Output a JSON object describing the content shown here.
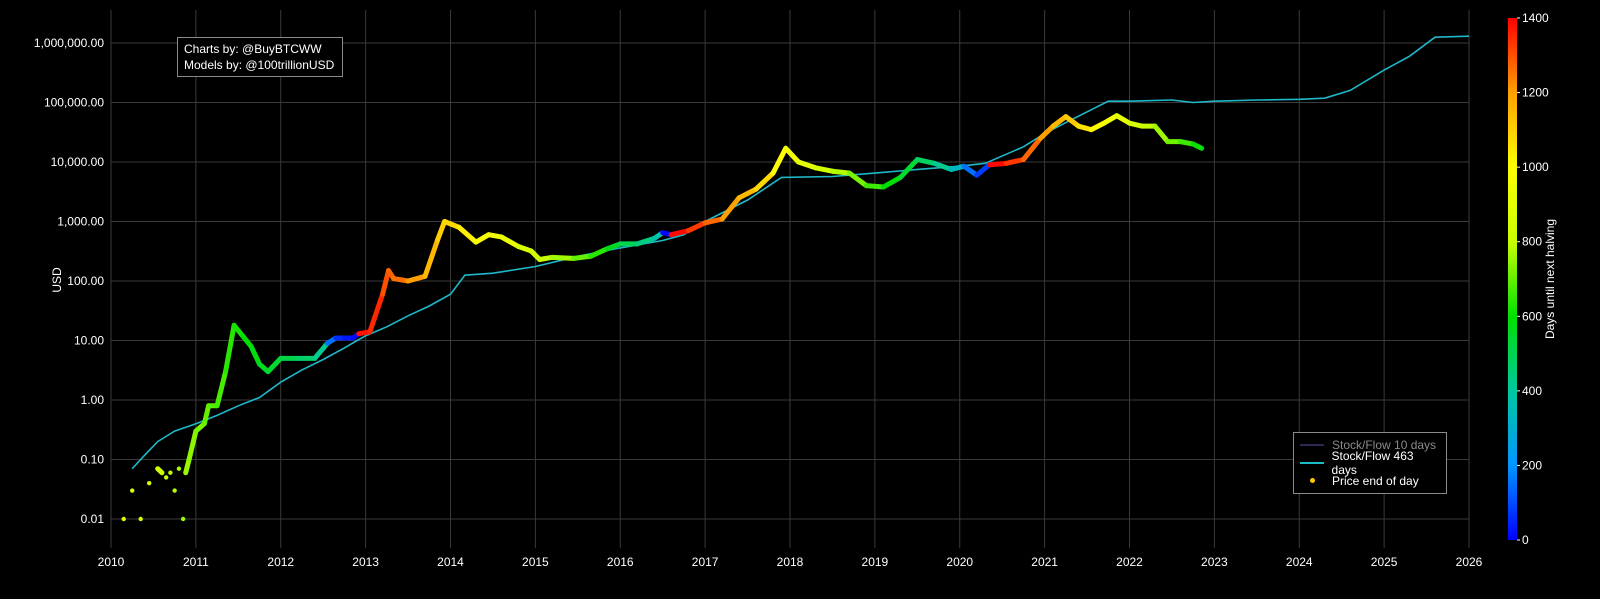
{
  "credits": {
    "line1": "Charts by: @BuyBTCWW",
    "line2": "Models by: @100trillionUSD"
  },
  "legend": {
    "sf10_label": "Stock/Flow 10 days",
    "sf463_label": "Stock/Flow 463 days",
    "price_label": "Price end of day"
  },
  "colors": {
    "background": "#000000",
    "grid": "#3a3a3a",
    "model_line": "#1fb8c8",
    "sf10_line": "#2a2a55",
    "colorbar_stops": [
      "#0000ff",
      "#0096ff",
      "#00c8a0",
      "#00e000",
      "#c8ff00",
      "#ffff00",
      "#ffa000",
      "#ff0000"
    ]
  },
  "chart_data": {
    "type": "scatter",
    "title": "",
    "xlabel": "",
    "ylabel": "USD",
    "y_scale": "log",
    "xlim": [
      2010,
      2026
    ],
    "ylim": [
      0.01,
      1000000
    ],
    "x_ticks": [
      "2010",
      "2011",
      "2012",
      "2013",
      "2014",
      "2015",
      "2016",
      "2017",
      "2018",
      "2019",
      "2020",
      "2021",
      "2022",
      "2023",
      "2024",
      "2025",
      "2026"
    ],
    "y_ticks": [
      {
        "value": 0.01,
        "label": "0.01"
      },
      {
        "value": 0.1,
        "label": "0.10"
      },
      {
        "value": 1,
        "label": "1.00"
      },
      {
        "value": 10,
        "label": "10.00"
      },
      {
        "value": 100,
        "label": "100.00"
      },
      {
        "value": 1000,
        "label": "1,000.00"
      },
      {
        "value": 10000,
        "label": "10,000.00"
      },
      {
        "value": 100000,
        "label": "100,000.00"
      },
      {
        "value": 1000000,
        "label": "1,000,000.00"
      }
    ],
    "grid": true,
    "legend_position": "bottom-right",
    "colorbar": {
      "label": "Days until next halving",
      "range": [
        0,
        1400
      ],
      "ticks": [
        0,
        200,
        400,
        600,
        800,
        1000,
        1200,
        1400
      ]
    },
    "series": [
      {
        "name": "Stock/Flow 463 days",
        "kind": "line",
        "points": [
          [
            2010.25,
            0.07
          ],
          [
            2010.4,
            0.12
          ],
          [
            2010.55,
            0.2
          ],
          [
            2010.75,
            0.3
          ],
          [
            2011.0,
            0.4
          ],
          [
            2011.25,
            0.55
          ],
          [
            2011.5,
            0.8
          ],
          [
            2011.75,
            1.1
          ],
          [
            2012.0,
            2.0
          ],
          [
            2012.25,
            3.2
          ],
          [
            2012.5,
            4.8
          ],
          [
            2012.75,
            7.5
          ],
          [
            2012.9,
            10
          ],
          [
            2013.0,
            12
          ],
          [
            2013.25,
            17
          ],
          [
            2013.5,
            26
          ],
          [
            2013.75,
            38
          ],
          [
            2014.0,
            60
          ],
          [
            2014.17,
            125
          ],
          [
            2014.5,
            135
          ],
          [
            2015.0,
            175
          ],
          [
            2015.5,
            260
          ],
          [
            2016.0,
            360
          ],
          [
            2016.5,
            480
          ],
          [
            2016.75,
            600
          ],
          [
            2017.0,
            1000
          ],
          [
            2017.5,
            2300
          ],
          [
            2017.9,
            5500
          ],
          [
            2018.5,
            5700
          ],
          [
            2019.0,
            6500
          ],
          [
            2019.5,
            7500
          ],
          [
            2020.0,
            8500
          ],
          [
            2020.3,
            9500
          ],
          [
            2020.75,
            18000
          ],
          [
            2021.0,
            30000
          ],
          [
            2021.3,
            50000
          ],
          [
            2021.75,
            105000
          ],
          [
            2022.0,
            105000
          ],
          [
            2022.5,
            110000
          ],
          [
            2022.75,
            100000
          ],
          [
            2023.0,
            105000
          ],
          [
            2023.5,
            110000
          ],
          [
            2024.0,
            113000
          ],
          [
            2024.3,
            118000
          ],
          [
            2024.6,
            160000
          ],
          [
            2025.0,
            350000
          ],
          [
            2025.3,
            600000
          ],
          [
            2025.6,
            1250000
          ],
          [
            2026.0,
            1300000
          ]
        ]
      },
      {
        "name": "Price end of day",
        "kind": "scatter",
        "points": [
          [
            2010.15,
            0.01,
            900
          ],
          [
            2010.25,
            0.03,
            880
          ],
          [
            2010.35,
            0.01,
            860
          ],
          [
            2010.45,
            0.04,
            840
          ],
          [
            2010.55,
            0.07,
            820
          ],
          [
            2010.6,
            0.06,
            810
          ],
          [
            2010.65,
            0.05,
            800
          ],
          [
            2010.7,
            0.06,
            790
          ],
          [
            2010.75,
            0.03,
            780
          ],
          [
            2010.8,
            0.07,
            770
          ],
          [
            2010.85,
            0.01,
            760
          ],
          [
            2010.88,
            0.06,
            755
          ],
          [
            2010.92,
            0.1,
            740
          ],
          [
            2011.0,
            0.3,
            720
          ],
          [
            2011.1,
            0.4,
            700
          ],
          [
            2011.15,
            0.8,
            690
          ],
          [
            2011.25,
            0.8,
            670
          ],
          [
            2011.35,
            3,
            640
          ],
          [
            2011.45,
            18,
            620
          ],
          [
            2011.55,
            12,
            600
          ],
          [
            2011.65,
            8,
            580
          ],
          [
            2011.75,
            4,
            560
          ],
          [
            2011.85,
            3,
            540
          ],
          [
            2012.0,
            5,
            510
          ],
          [
            2012.2,
            5,
            470
          ],
          [
            2012.4,
            5,
            420
          ],
          [
            2012.55,
            9,
            150
          ],
          [
            2012.65,
            11,
            60
          ],
          [
            2012.75,
            11,
            30
          ],
          [
            2012.85,
            11,
            10
          ],
          [
            2012.92,
            13,
            1380
          ],
          [
            2013.05,
            14,
            1350
          ],
          [
            2013.2,
            60,
            1300
          ],
          [
            2013.27,
            150,
            1280
          ],
          [
            2013.33,
            110,
            1260
          ],
          [
            2013.5,
            100,
            1200
          ],
          [
            2013.7,
            120,
            1150
          ],
          [
            2013.85,
            500,
            1100
          ],
          [
            2013.93,
            1000,
            1080
          ],
          [
            2014.1,
            800,
            1030
          ],
          [
            2014.3,
            450,
            980
          ],
          [
            2014.45,
            600,
            950
          ],
          [
            2014.6,
            550,
            920
          ],
          [
            2014.8,
            380,
            860
          ],
          [
            2014.95,
            320,
            830
          ],
          [
            2015.05,
            230,
            800
          ],
          [
            2015.2,
            250,
            760
          ],
          [
            2015.45,
            240,
            700
          ],
          [
            2015.65,
            260,
            640
          ],
          [
            2015.85,
            350,
            560
          ],
          [
            2016.0,
            420,
            500
          ],
          [
            2016.2,
            420,
            440
          ],
          [
            2016.4,
            520,
            380
          ],
          [
            2016.5,
            650,
            5
          ],
          [
            2016.6,
            600,
            1390
          ],
          [
            2016.8,
            700,
            1330
          ],
          [
            2017.0,
            950,
            1270
          ],
          [
            2017.2,
            1100,
            1200
          ],
          [
            2017.4,
            2500,
            1150
          ],
          [
            2017.6,
            3500,
            1080
          ],
          [
            2017.8,
            6500,
            1000
          ],
          [
            2017.95,
            17000,
            960
          ],
          [
            2018.1,
            10000,
            900
          ],
          [
            2018.3,
            8000,
            840
          ],
          [
            2018.5,
            7000,
            780
          ],
          [
            2018.7,
            6500,
            720
          ],
          [
            2018.9,
            4000,
            660
          ],
          [
            2019.1,
            3800,
            600
          ],
          [
            2019.3,
            5500,
            540
          ],
          [
            2019.5,
            11000,
            480
          ],
          [
            2019.7,
            9500,
            420
          ],
          [
            2019.9,
            7500,
            330
          ],
          [
            2020.05,
            8500,
            150
          ],
          [
            2020.2,
            6000,
            80
          ],
          [
            2020.35,
            9000,
            1390
          ],
          [
            2020.55,
            9500,
            1330
          ],
          [
            2020.75,
            11000,
            1270
          ],
          [
            2020.95,
            25000,
            1200
          ],
          [
            2021.1,
            40000,
            1150
          ],
          [
            2021.25,
            58000,
            1110
          ],
          [
            2021.4,
            40000,
            1060
          ],
          [
            2021.55,
            35000,
            1010
          ],
          [
            2021.7,
            45000,
            960
          ],
          [
            2021.85,
            60000,
            900
          ],
          [
            2022.0,
            45000,
            850
          ],
          [
            2022.15,
            40000,
            800
          ],
          [
            2022.3,
            40000,
            760
          ],
          [
            2022.45,
            22000,
            710
          ],
          [
            2022.6,
            22000,
            660
          ],
          [
            2022.75,
            20000,
            610
          ],
          [
            2022.85,
            17000,
            580
          ]
        ]
      }
    ]
  }
}
